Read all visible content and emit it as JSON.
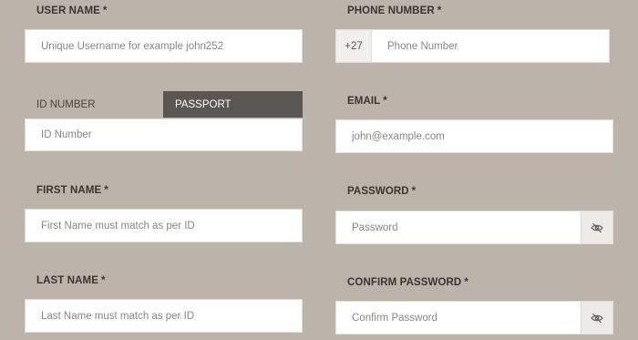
{
  "form": {
    "username": {
      "label": "USER NAME",
      "required_mark": "*",
      "placeholder": "Unique Username for example john252"
    },
    "phone": {
      "label": "PHONE NUMBER",
      "required_mark": "*",
      "prefix": "+27",
      "placeholder": "Phone Number"
    },
    "id_tabs": {
      "id_number_label": "ID NUMBER",
      "passport_label": "PASSPORT",
      "active": "PASSPORT"
    },
    "id_number": {
      "placeholder": "ID Number"
    },
    "email": {
      "label": "EMAIL",
      "required_mark": "*",
      "placeholder": "john@example.com"
    },
    "first_name": {
      "label": "FIRST NAME",
      "required_mark": "*",
      "placeholder": "First Name must match as per ID"
    },
    "password": {
      "label": "PASSWORD",
      "required_mark": "*",
      "placeholder": "Password",
      "toggle_icon": "eye-off-icon"
    },
    "last_name": {
      "label": "LAST NAME",
      "required_mark": "*",
      "placeholder": "Last Name must match as per ID"
    },
    "confirm_password": {
      "label": "CONFIRM PASSWORD",
      "required_mark": "*",
      "placeholder": "Confirm Password",
      "toggle_icon": "eye-off-icon"
    }
  },
  "colors": {
    "background": "#bcb3aa",
    "field_background": "#ffffff",
    "active_tab": "#5a5653",
    "label_text": "#3a3532"
  }
}
